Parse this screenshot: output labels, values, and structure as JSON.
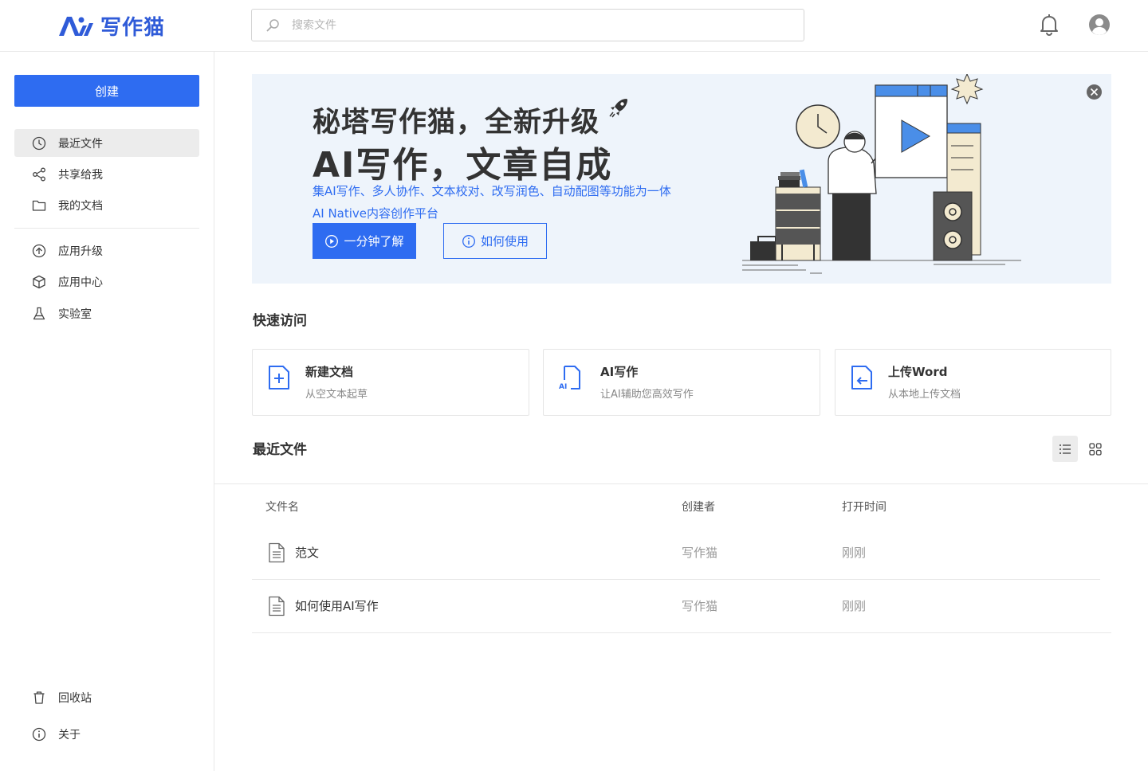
{
  "header": {
    "app_name": "写作猫",
    "search_placeholder": "搜索文件"
  },
  "sidebar": {
    "create_label": "创建",
    "items": [
      {
        "label": "最近文件",
        "icon": "clock-icon"
      },
      {
        "label": "共享给我",
        "icon": "share-icon"
      },
      {
        "label": "我的文档",
        "icon": "folder-icon"
      },
      {
        "label": "应用升级",
        "icon": "upgrade-icon"
      },
      {
        "label": "应用中心",
        "icon": "cube-icon"
      },
      {
        "label": "实验室",
        "icon": "flask-icon"
      },
      {
        "label": "回收站",
        "icon": "trash-icon"
      },
      {
        "label": "关于",
        "icon": "info-icon"
      }
    ]
  },
  "banner": {
    "title1": "秘塔写作猫，全新升级",
    "title2": "AI写作，文章自成",
    "sub1": "集AI写作、多人协作、文本校对、改写润色、自动配图等功能为一体",
    "sub2": "AI Native内容创作平台",
    "btn_primary": "一分钟了解",
    "btn_outline": "如何使用"
  },
  "quick_access": {
    "title": "快速访问",
    "cards": [
      {
        "title": "新建文档",
        "desc": "从空文本起草",
        "icon": "new-doc-icon"
      },
      {
        "title": "AI写作",
        "desc": "让AI辅助您高效写作",
        "icon": "ai-doc-icon"
      },
      {
        "title": "上传Word",
        "desc": "从本地上传文档",
        "icon": "upload-doc-icon"
      }
    ]
  },
  "recent": {
    "title": "最近文件",
    "columns": [
      "文件名",
      "创建者",
      "打开时间"
    ],
    "rows": [
      {
        "name": "范文",
        "creator": "写作猫",
        "opened": "刚刚"
      },
      {
        "name": "如何使用AI写作",
        "creator": "写作猫",
        "opened": "刚刚"
      }
    ]
  },
  "colors": {
    "brand": "#2e6cf1",
    "banner_bg": "#eef4fb"
  }
}
